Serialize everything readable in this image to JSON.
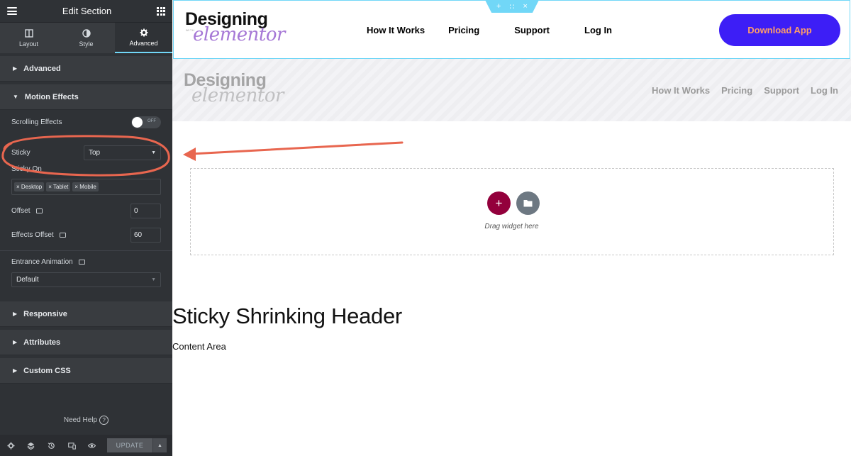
{
  "panel": {
    "title": "Edit Section",
    "tabs": [
      {
        "label": "Layout",
        "icon": "layout-icon"
      },
      {
        "label": "Style",
        "icon": "style-halfcircle-icon"
      },
      {
        "label": "Advanced",
        "icon": "gear-icon",
        "active": true
      }
    ],
    "sections": {
      "advanced": "Advanced",
      "motion_effects": "Motion Effects",
      "responsive": "Responsive",
      "attributes": "Attributes",
      "custom_css": "Custom CSS"
    },
    "motion": {
      "scrolling_label": "Scrolling Effects",
      "scrolling_state": "OFF",
      "sticky_label": "Sticky",
      "sticky_value": "Top",
      "sticky_on_label": "Sticky On",
      "sticky_on_tags": [
        "Desktop",
        "Tablet",
        "Mobile"
      ],
      "offset_label": "Offset",
      "offset_value": "0",
      "effects_offset_label": "Effects Offset",
      "effects_offset_value": "60",
      "entrance_label": "Entrance Animation",
      "entrance_value": "Default"
    },
    "need_help": "Need Help",
    "update_label": "UPDATE"
  },
  "site": {
    "logo_line1": "Designing",
    "logo_small": "WITH",
    "logo_line2": "elementor",
    "nav": [
      "How It Works",
      "Pricing",
      "Support",
      "Log In"
    ],
    "cta": "Download App"
  },
  "canvas": {
    "drag_hint": "Drag widget here",
    "heading": "Sticky Shrinking Header",
    "content": "Content Area"
  },
  "colors": {
    "panel_bg": "#2f3236",
    "accent_cyan": "#71d7f7",
    "cta_bg": "#3d1ef6",
    "cta_text": "#ff9e68",
    "logo_purple": "#a678d6",
    "add_button": "#93003c",
    "annotation_red": "#e8664f"
  }
}
